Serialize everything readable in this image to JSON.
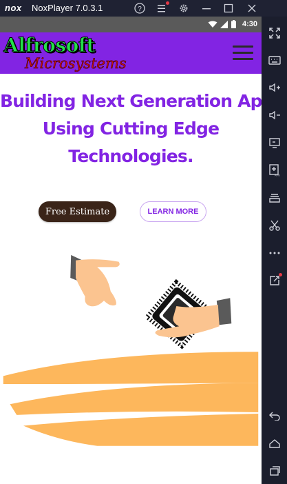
{
  "window": {
    "logo": "nox",
    "title": "NoxPlayer 7.0.3.1",
    "controls": [
      "help-icon",
      "menu-icon",
      "settings-icon",
      "minimize-icon",
      "maximize-icon",
      "close-icon"
    ]
  },
  "statusbar": {
    "time": "4:30"
  },
  "site": {
    "logo_main": "Alfrosoft",
    "logo_sub": "Microsystems",
    "hero_lines": [
      "Building Next Generation Apps",
      "Using Cutting Edge",
      "Technologies."
    ],
    "buttons": {
      "estimate": "Free Estimate",
      "learn_more": "LEARN MORE"
    }
  },
  "sidebar": {
    "tools": [
      "fullscreen-icon",
      "keyboard-icon",
      "volume-up-icon",
      "volume-down-icon",
      "screen-icon",
      "apk-install-icon",
      "multi-instance-icon",
      "scissors-icon",
      "more-icon",
      "share-icon",
      "back-icon",
      "home-icon",
      "recents-icon"
    ]
  },
  "colors": {
    "brand": "#8224e3",
    "button_dark": "#3a2418",
    "illustration_orange": "#fdb75c",
    "nox_dark": "#1b1e2d"
  }
}
